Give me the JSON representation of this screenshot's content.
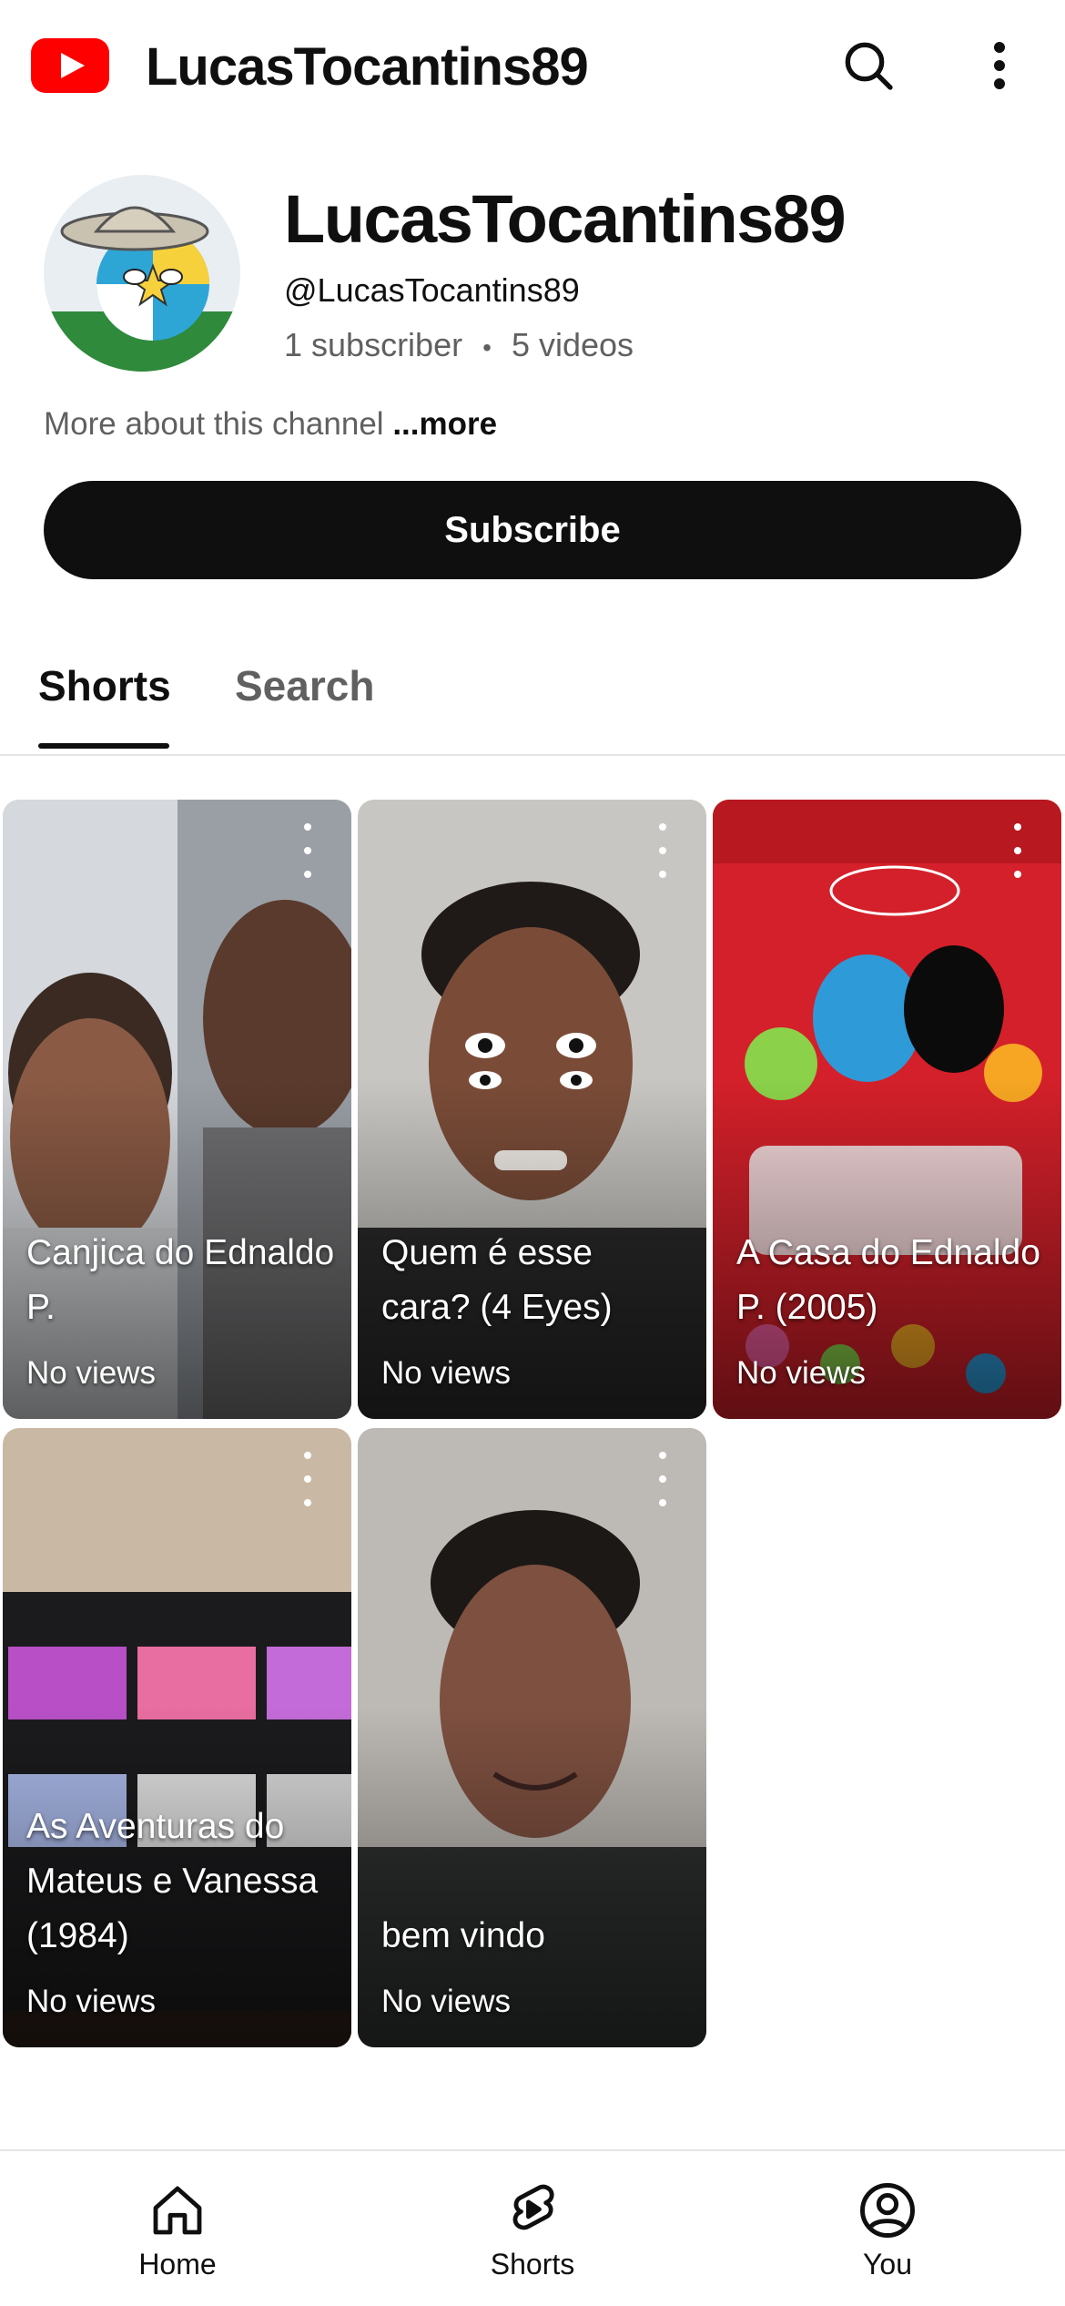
{
  "app_bar": {
    "title": "LucasTocantins89",
    "logo_icon": "youtube-logo-icon",
    "search_icon": "search-icon",
    "more_icon": "more-vertical-icon",
    "brand_color": "#ff0000"
  },
  "channel": {
    "name": "LucasTocantins89",
    "handle": "@LucasTocantins89",
    "subscribers": "1 subscriber",
    "separator": "•",
    "videos": "5 videos",
    "about": "More about this channel",
    "more_link": "...more",
    "subscribe_label": "Subscribe",
    "subscribe_color": "#0f0f0f"
  },
  "tabs": [
    {
      "label": "Shorts",
      "active": true
    },
    {
      "label": "Search",
      "active": false
    }
  ],
  "shorts": [
    {
      "title": "Canjica do Ednaldo P.",
      "views": "No views"
    },
    {
      "title": "Quem é esse cara? (4 Eyes)",
      "views": "No views"
    },
    {
      "title": "A Casa do Ednaldo P. (2005)",
      "views": "No views"
    },
    {
      "title": "As Aventuras do Mateus e Vanessa (1984)",
      "views": "No views"
    },
    {
      "title": "bem vindo",
      "views": "No views"
    }
  ],
  "bottom_nav": [
    {
      "label": "Home",
      "icon": "home-icon"
    },
    {
      "label": "Shorts",
      "icon": "shorts-icon"
    },
    {
      "label": "You",
      "icon": "account-circle-icon"
    }
  ]
}
